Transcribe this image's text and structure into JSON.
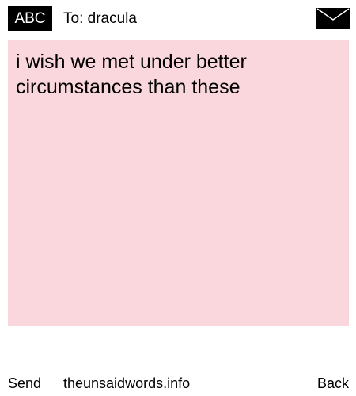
{
  "header": {
    "mode_label": "ABC",
    "recipient": "To: dracula",
    "envelope_icon": "envelope-icon"
  },
  "message": {
    "text": "i wish we met under better circumstances than these",
    "background_color": "#f9d7dc"
  },
  "footer": {
    "send_label": "Send",
    "site_label": "theunsaidwords.info",
    "back_label": "Back"
  }
}
